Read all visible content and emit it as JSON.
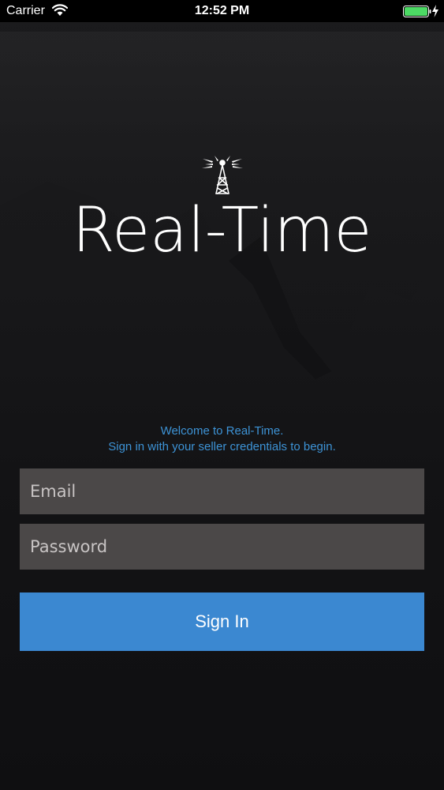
{
  "status_bar": {
    "carrier": "Carrier",
    "time": "12:52 PM",
    "wifi_icon": "wifi-icon",
    "battery_icon": "battery-full-icon",
    "charging_icon": "bolt-icon"
  },
  "logo": {
    "icon": "radio-tower-icon",
    "title": "Real-Time"
  },
  "welcome": {
    "line1": "Welcome to Real-Time.",
    "line2": "Sign in with your seller credentials to begin."
  },
  "form": {
    "email_placeholder": "Email",
    "password_placeholder": "Password",
    "sign_in_label": "Sign In"
  },
  "colors": {
    "accent": "#3b88d1",
    "welcome_text": "#3d93d6",
    "field_background": "#4b4848",
    "battery": "#4cd964"
  }
}
